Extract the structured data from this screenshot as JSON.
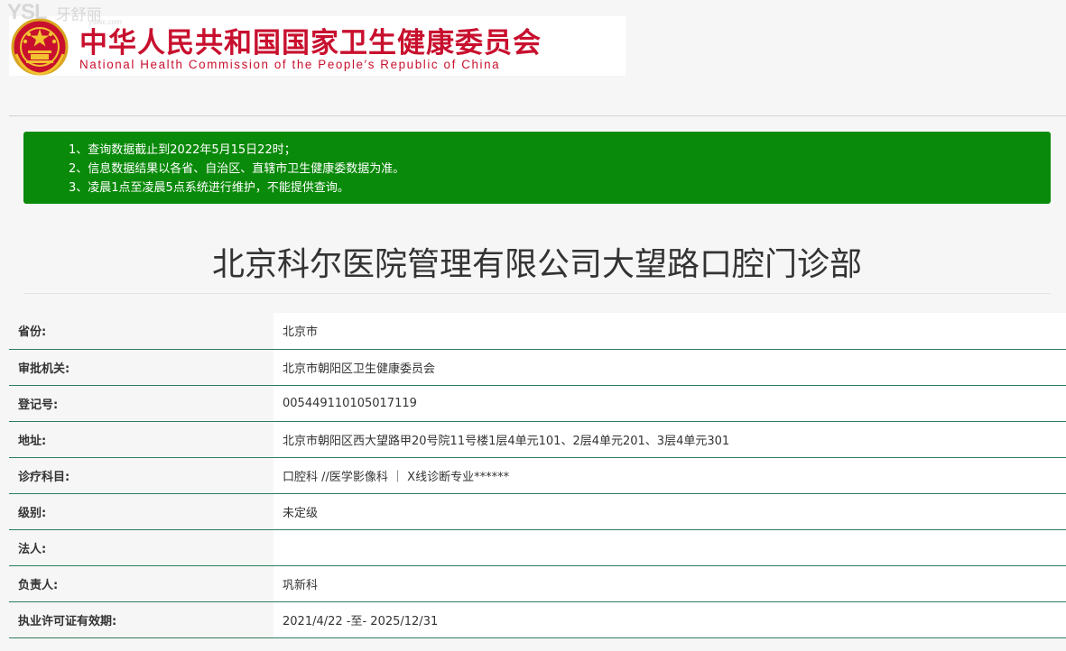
{
  "watermark": {
    "brand": "YSL",
    "name": "牙舒丽",
    "url": "yslwc.com"
  },
  "header": {
    "emblem_icon": "national-emblem-icon",
    "org_name_cn": "中华人民共和国国家卫生健康委员会",
    "org_name_en": "National Health Commission of the People′s Republic of China",
    "brand_color": "#c8102e"
  },
  "notice": {
    "background": "#0a8a0a",
    "lines": [
      "1、查询数据截止到2022年5月15日22时；",
      "2、信息数据结果以各省、自治区、直辖市卫生健康委数据为准。",
      "3、凌晨1点至凌晨5点系统进行维护，不能提供查询。"
    ]
  },
  "clinic": {
    "name": "北京科尔医院管理有限公司大望路口腔门诊部",
    "fields": [
      {
        "label": "省份:",
        "value": "北京市"
      },
      {
        "label": "审批机关:",
        "value": "北京市朝阳区卫生健康委员会"
      },
      {
        "label": "登记号:",
        "value": "005449110105017119"
      },
      {
        "label": "地址:",
        "value": "北京市朝阳区西大望路甲20号院11号楼1层4单元101、2层4单元201、3层4单元301"
      },
      {
        "label": "诊疗科目:",
        "value": "口腔科 //医学影像科 ｜ X线诊断专业******"
      },
      {
        "label": "级别:",
        "value": "未定级"
      },
      {
        "label": "法人:",
        "value": ""
      },
      {
        "label": "负责人:",
        "value": "巩新科"
      },
      {
        "label": "执业许可证有效期:",
        "value": "2021/4/22 -至- 2025/12/31"
      }
    ]
  }
}
